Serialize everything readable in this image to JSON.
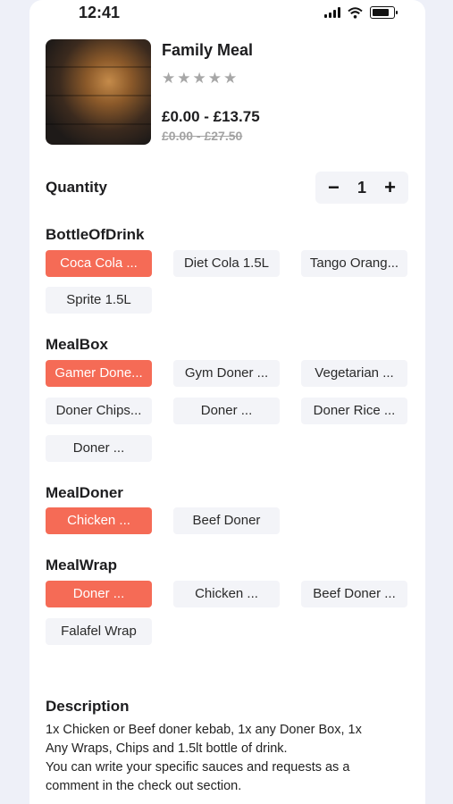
{
  "status": {
    "time": "12:41"
  },
  "product": {
    "name": "Family Meal",
    "rating": 0,
    "stars": 5,
    "price": "£0.00 - £13.75",
    "old_price": "£0.00 - £27.50"
  },
  "quantity": {
    "label": "Quantity",
    "value": "1",
    "minus": "−",
    "plus": "+"
  },
  "groups": {
    "drink": {
      "title": "BottleOfDrink",
      "options": [
        "Coca Cola ...",
        "Diet Cola 1.5L",
        "Tango Orang...",
        "Sprite 1.5L"
      ]
    },
    "mealbox": {
      "title": "MealBox",
      "options": [
        "Gamer Done...",
        "Gym Doner ...",
        "Vegetarian ...",
        "Doner Chips...",
        "Doner ...",
        "Doner Rice ...",
        "Doner ..."
      ]
    },
    "mealdoner": {
      "title": "MealDoner",
      "options": [
        "Chicken ...",
        "Beef Doner"
      ]
    },
    "mealwrap": {
      "title": "MealWrap",
      "options": [
        "Doner ...",
        "Chicken ...",
        "Beef Doner ...",
        "Falafel Wrap"
      ]
    }
  },
  "description": {
    "title": "Description",
    "lines": [
      "1x Chicken or Beef doner kebab, 1x any Doner Box, 1x",
      "Any Wraps, Chips and 1.5lt bottle of drink.",
      "You can write your specific sauces and requests as a",
      "comment in the check out section."
    ]
  },
  "colors": {
    "accent": "#f56b56",
    "chip_bg": "#f3f4f8",
    "star": "#a7a7a7"
  }
}
